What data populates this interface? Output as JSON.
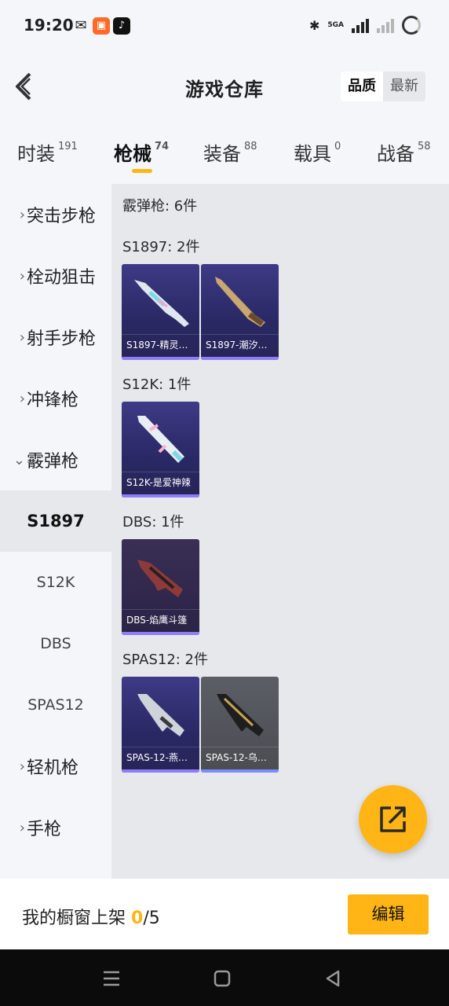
{
  "status_bar": {
    "time": "19:20",
    "network": "5GA",
    "icons": [
      "wechat-icon",
      "app-icon",
      "tiktok-icon",
      "bluetooth-icon",
      "signal-icon",
      "signal-icon",
      "loading-icon"
    ]
  },
  "header": {
    "title": "游戏仓库",
    "sort_options": [
      "品质",
      "最新"
    ],
    "active_sort": "品质"
  },
  "tabs": [
    {
      "label": "时装",
      "count": "191"
    },
    {
      "label": "枪械",
      "count": "74"
    },
    {
      "label": "装备",
      "count": "88"
    },
    {
      "label": "载具",
      "count": "0"
    },
    {
      "label": "战备",
      "count": "58"
    }
  ],
  "active_tab": "枪械",
  "sidebar": {
    "items": [
      {
        "label": "突击步枪",
        "type": "category"
      },
      {
        "label": "栓动狙击",
        "type": "category"
      },
      {
        "label": "射手步枪",
        "type": "category"
      },
      {
        "label": "冲锋枪",
        "type": "category"
      },
      {
        "label": "霰弹枪",
        "type": "category-open"
      },
      {
        "label": "S1897",
        "type": "sub-selected"
      },
      {
        "label": "S12K",
        "type": "sub"
      },
      {
        "label": "DBS",
        "type": "sub"
      },
      {
        "label": "SPAS12",
        "type": "sub"
      },
      {
        "label": "轻机枪",
        "type": "category"
      },
      {
        "label": "手枪",
        "type": "category"
      }
    ]
  },
  "content": {
    "total_label": "霰弹枪: 6件",
    "groups": [
      {
        "label": "S1897: 2件",
        "items": [
          "S1897-精灵…",
          "S1897-潮汐…"
        ]
      },
      {
        "label": "S12K: 1件",
        "items": [
          "S12K-是爱神辣"
        ]
      },
      {
        "label": "DBS: 1件",
        "items": [
          "DBS-焰鹰斗篷"
        ]
      },
      {
        "label": "SPAS12: 2件",
        "items": [
          "SPAS-12-燕…",
          "SPAS-12-乌…"
        ]
      }
    ]
  },
  "bottom_bar": {
    "label": "我的橱窗上架 ",
    "current": "0",
    "total": "/5",
    "edit_label": "编辑"
  },
  "colors": {
    "accent": "#ffb515",
    "card_bg": "#2b2966",
    "card_bar": "#8f7cf7"
  }
}
